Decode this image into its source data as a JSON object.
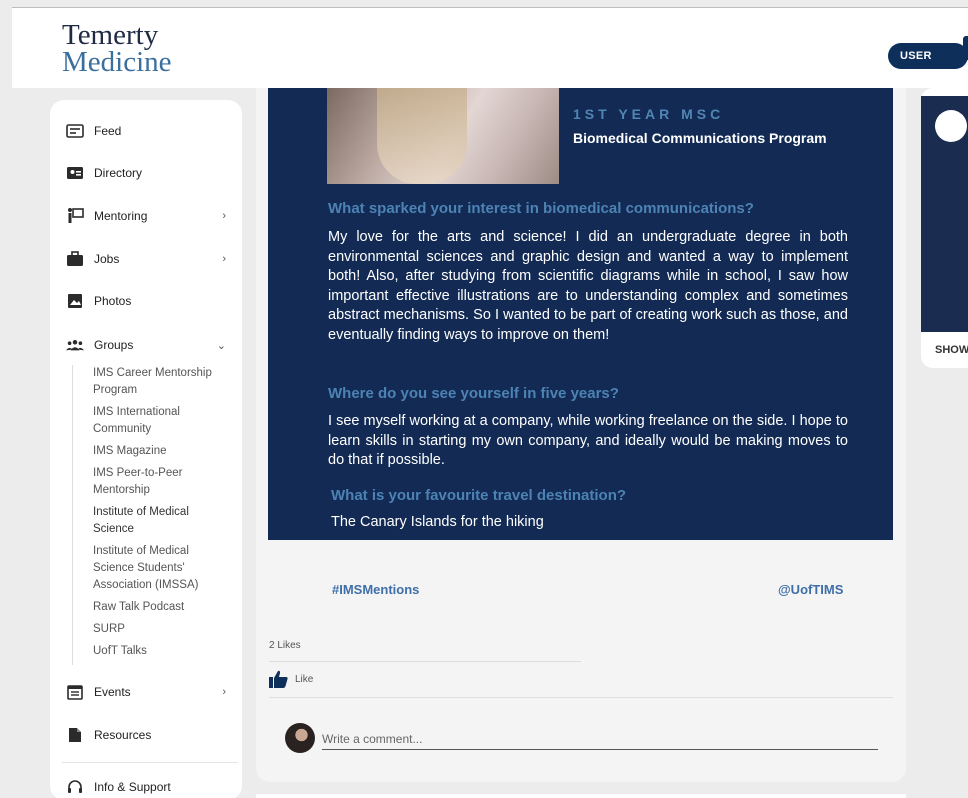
{
  "header": {
    "logo_line1": "Temerty",
    "logo_line2": "Medicine",
    "user_view": "USER VIEW"
  },
  "sidebar": {
    "items": [
      {
        "label": "Feed"
      },
      {
        "label": "Directory"
      },
      {
        "label": "Mentoring"
      },
      {
        "label": "Jobs"
      },
      {
        "label": "Photos"
      },
      {
        "label": "Groups"
      },
      {
        "label": "Events"
      },
      {
        "label": "Resources"
      },
      {
        "label": "Info & Support"
      }
    ],
    "groups": [
      "IMS Career Mentorship Program",
      "IMS International Community",
      "IMS Magazine",
      "IMS Peer-to-Peer Mentorship",
      "Institute of Medical Science",
      "Institute of Medical Science Students' Association (IMSSA)",
      "Raw Talk Podcast",
      "SURP",
      "UofT Talks"
    ]
  },
  "post": {
    "year": "1ST YEAR MSC",
    "program": "Biomedical Communications Program",
    "q1": "What sparked your interest in biomedical communications?",
    "a1": "My love for the arts and science! I did an undergraduate degree in both environmental sciences and graphic design and wanted a way to implement both! Also, after studying from scientific diagrams while in school, I saw how important effective illustrations are to understanding complex and sometimes abstract mechanisms. So I wanted to be part of creating work such as those, and eventually finding ways to improve on them!",
    "q2": "Where do you see yourself in five years?",
    "a2": "I see myself working at a company, while working freelance on the side. I hope to learn skills in starting my own company, and ideally would be making moves to do that if possible.",
    "q3": "What is your favourite travel destination?",
    "a3": "The Canary Islands for the hiking",
    "hashtag": "#IMSMentions",
    "handle": "@UofTIMS",
    "likes": "2 Likes",
    "like_label": "Like",
    "comment_placeholder": "Write a comment..."
  },
  "right_panel": {
    "show_label": "SHOW"
  }
}
